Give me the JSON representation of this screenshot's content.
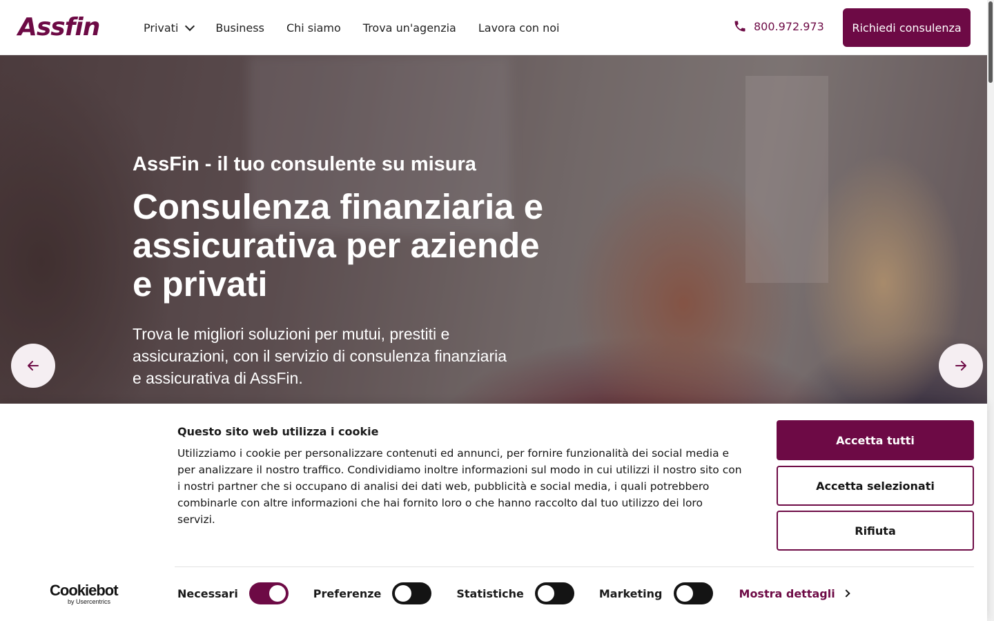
{
  "header": {
    "logo_text": "Assfin",
    "nav": [
      {
        "label": "Privati",
        "has_dropdown": true
      },
      {
        "label": "Business"
      },
      {
        "label": "Chi siamo"
      },
      {
        "label": "Trova un'agenzia"
      },
      {
        "label": "Lavora con noi"
      }
    ],
    "phone": "800.972.973",
    "cta": "Richiedi consulenza"
  },
  "hero": {
    "eyebrow": "AssFin - il tuo consulente su misura",
    "title": "Consulenza finanziaria e assicurativa per aziende e privati",
    "text": "Trova le migliori soluzioni per mutui, prestiti e assicurazioni, con il servizio di consulenza finanziaria e assicurativa di AssFin."
  },
  "cookie": {
    "title": "Questo sito web utilizza i cookie",
    "text": "Utilizziamo i cookie per personalizzare contenuti ed annunci, per fornire funzionalità dei social media e per analizzare il nostro traffico. Condividiamo inoltre informazioni sul modo in cui utilizzi il nostro sito con i nostri partner che si occupano di analisi dei dati web, pubblicità e social media, i quali potrebbero combinarle con altre informazioni che hai fornito loro o che hanno raccolto dal tuo utilizzo dei loro servizi.",
    "accept_all": "Accetta tutti",
    "accept_selected": "Accetta selezionati",
    "reject": "Rifiuta",
    "toggles": [
      {
        "label": "Necessari",
        "on": true
      },
      {
        "label": "Preferenze",
        "on": false
      },
      {
        "label": "Statistiche",
        "on": false
      },
      {
        "label": "Marketing",
        "on": false
      }
    ],
    "details_label": "Mostra dettagli",
    "cookiebot_main": "Cookiebot",
    "cookiebot_sub": "by Usercentrics"
  },
  "colors": {
    "brand": "#6d0a45"
  },
  "icons": [
    "phone-icon",
    "chevron-down-icon",
    "arrow-left-icon",
    "arrow-right-icon",
    "chevron-right-icon"
  ]
}
